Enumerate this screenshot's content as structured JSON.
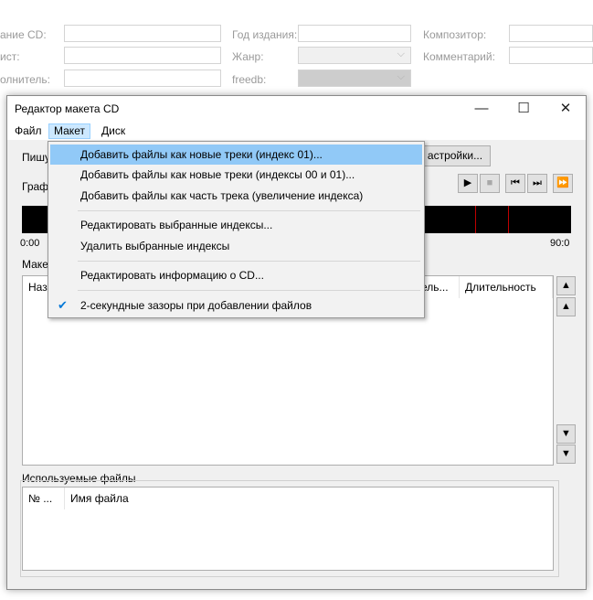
{
  "background_form": {
    "label_album": "ание CD:",
    "label_artist": "ист:",
    "label_performer": "олнитель:",
    "label_year": "Год издания:",
    "label_genre": "Жанр:",
    "label_freedb": "freedb:",
    "label_composer": "Композитор:",
    "label_comment": "Комментарий:",
    "combo_arrow": "⌵"
  },
  "dialog": {
    "title": "Редактор макета CD",
    "minimize": "—",
    "maximize": "☐",
    "close": "✕",
    "menu": {
      "file": "Файл",
      "layout": "Макет",
      "disc": "Диск"
    },
    "write_label": "Пишу",
    "settings_button": "астройки...",
    "graph_label": "Граф",
    "timeline_start": "0:00",
    "timeline_end": "90:0",
    "layout_label": "Макет",
    "transport": {
      "play": "▶",
      "stop": "■",
      "prev": "⏮",
      "next": "⏭",
      "forward": "⏩"
    },
    "tracks_columns": [
      "Наз",
      "ель...",
      "Длительность"
    ],
    "side_buttons": {
      "top": "▲",
      "up": "▲",
      "down": "▼",
      "bottom": "▼"
    },
    "used_files_label": "Используемые файлы",
    "files_columns": [
      "№ ...",
      "Имя файла"
    ]
  },
  "dropdown": {
    "items": [
      "Добавить файлы как новые треки (индекс 01)...",
      "Добавить файлы как новые треки (индексы 00 и 01)...",
      "Добавить файлы как часть трека (увеличение индекса)",
      "Редактировать выбранные индексы...",
      "Удалить выбранные индексы",
      "Редактировать информацию о CD...",
      "2-секундные зазоры при добавлении файлов"
    ],
    "check_mark": "✔"
  },
  "colors": {
    "highlight": "#91c9f7",
    "menu_active": "#cce8ff",
    "marker": "#c00000",
    "check": "#0078d7"
  }
}
